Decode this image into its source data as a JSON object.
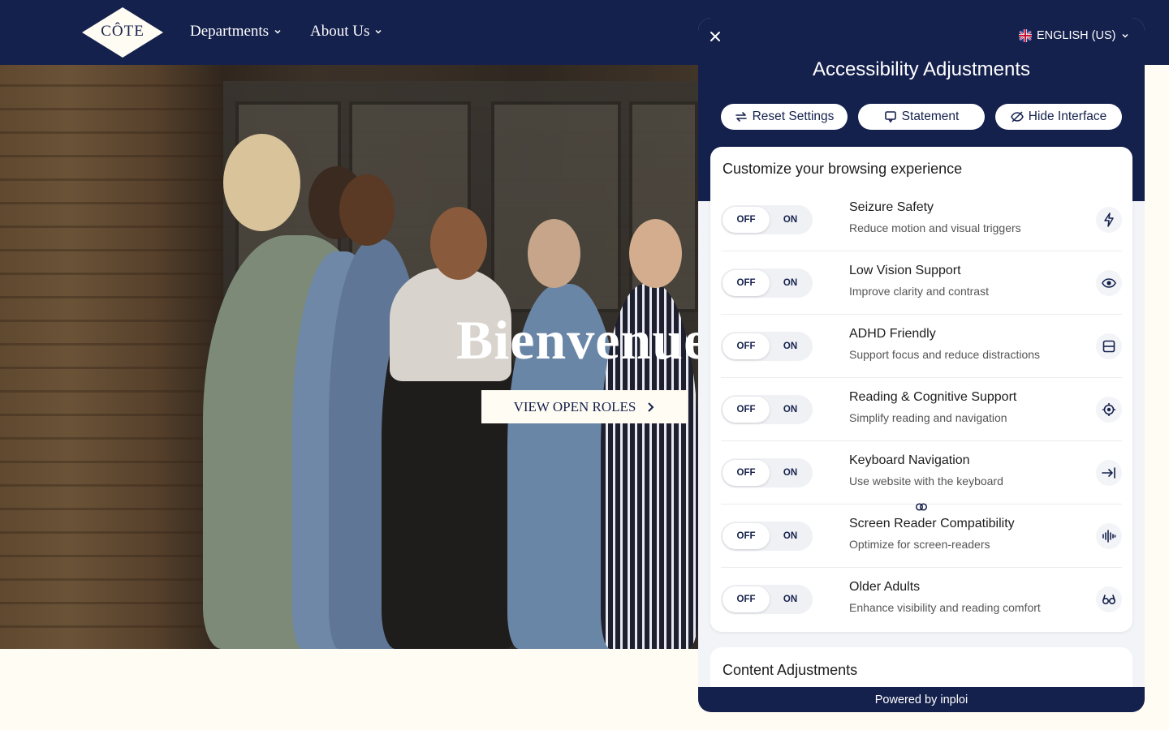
{
  "header": {
    "logo_text": "CÔTE",
    "nav": [
      {
        "label": "Departments"
      },
      {
        "label": "About Us"
      }
    ]
  },
  "hero": {
    "title": "Bienvenue",
    "button_label": "VIEW OPEN ROLES"
  },
  "panel": {
    "language": "ENGLISH (US)",
    "title": "Accessibility Adjustments",
    "buttons": {
      "reset": "Reset Settings",
      "statement": "Statement",
      "hide": "Hide Interface"
    },
    "section_title": "Customize your browsing experience",
    "toggle_off": "OFF",
    "toggle_on": "ON",
    "profiles": [
      {
        "title": "Seizure Safety",
        "desc": "Reduce motion and visual triggers",
        "icon": "lightning-icon"
      },
      {
        "title": "Low Vision Support",
        "desc": "Improve clarity and contrast",
        "icon": "eye-icon"
      },
      {
        "title": "ADHD Friendly",
        "desc": "Support focus and reduce distractions",
        "icon": "focus-frame-icon"
      },
      {
        "title": "Reading & Cognitive Support",
        "desc": "Simplify reading and navigation",
        "icon": "target-icon"
      },
      {
        "title": "Keyboard Navigation",
        "desc": "Use website with the keyboard",
        "icon": "tab-arrow-icon"
      },
      {
        "title": "Screen Reader Compatibility",
        "desc": "Optimize for screen-readers",
        "icon": "audio-wave-icon"
      },
      {
        "title": "Older Adults",
        "desc": "Enhance visibility and reading comfort",
        "icon": "glasses-icon"
      }
    ],
    "content_section_title": "Content Adjustments",
    "footer": "Powered by inploi"
  },
  "colors": {
    "navy": "#15214d",
    "cream": "#fffcf3",
    "panel_bg": "#f3f4f8"
  }
}
